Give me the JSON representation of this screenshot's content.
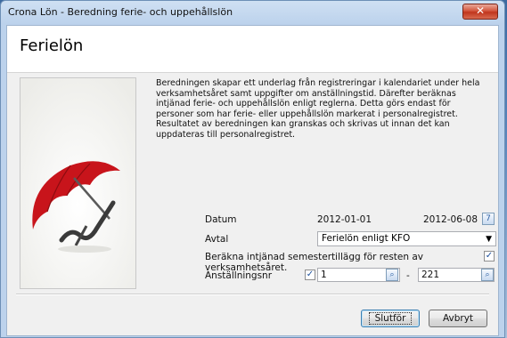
{
  "window": {
    "title": "Crona Lön - Beredning ferie- och uppehållslön",
    "close_label": "✕"
  },
  "header": {
    "title": "Ferielön"
  },
  "description": "Beredningen skapar ett underlag från registreringar i kalendariet under hela verksamhetsåret samt uppgifter om anställningstid. Därefter beräknas intjänad ferie- och uppehållslön enligt reglerna. Detta görs endast för personer som har ferie- eller uppehållslön markerat i personalregistret. Resultatet av beredningen kan granskas och skrivas ut innan det kan uppdateras till personalregistret.",
  "form": {
    "datum_label": "Datum",
    "datum_from": "2012-01-01",
    "datum_to": "2012-06-08",
    "calendar_icon_glyph": "7",
    "avtal_label": "Avtal",
    "avtal_value": "Ferielön enligt KFO",
    "semester_label": "Beräkna intjänad semestertillägg för resten av verksamhetsåret.",
    "semester_checked": true,
    "anst_label": "Anställningsnr",
    "anst_checked": true,
    "anst_from": "1",
    "anst_dash": "-",
    "anst_to": "221"
  },
  "buttons": {
    "finish": "Slutför",
    "cancel": "Avbryt"
  },
  "colors": {
    "accent": "#3c7fb1",
    "close_red": "#c0351d",
    "umbrella_red": "#c8141b"
  }
}
